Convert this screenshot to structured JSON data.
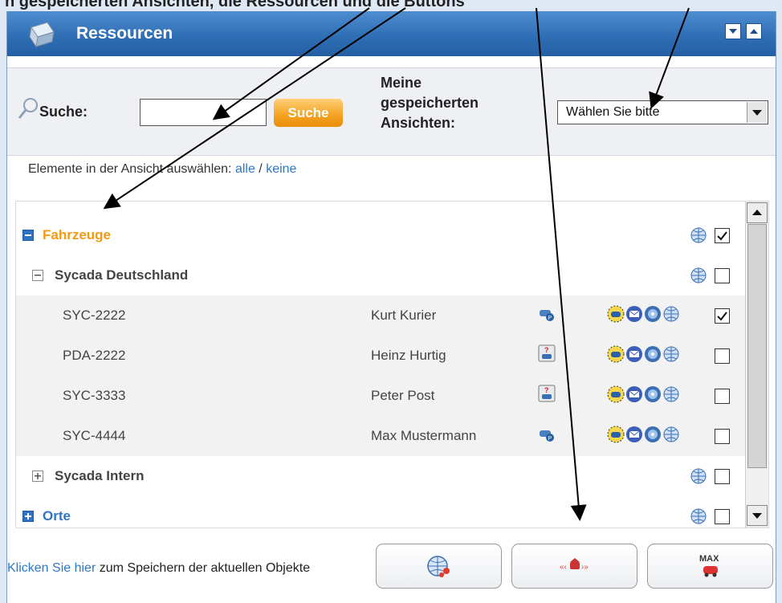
{
  "banner": {
    "text": "n gespeicherten Ansichten, die Ressourcen und die Buttons"
  },
  "window": {
    "title": "Ressourcen",
    "title_icon": "ressourcen-icon",
    "minimize_icon": "minimize-icon",
    "maximize_icon": "maximize-icon"
  },
  "search": {
    "label": "Suche:",
    "input_value": "",
    "button_label": "Suche",
    "views_label": "Meine gespeicherten Ansichten:",
    "views_selected": "Wählen Sie bitte"
  },
  "selection": {
    "prefix": "Elemente in der Ansicht auswählen: ",
    "all_link": "alle",
    "separator": " / ",
    "none_link": "keine"
  },
  "tree": {
    "groups": [
      {
        "label": "Fahrzeuge",
        "expanded": true,
        "checked": true
      },
      {
        "label": "Sycada Deutschland",
        "expanded": true,
        "checked": false
      },
      {
        "label": "Sycada Intern",
        "expanded": false,
        "checked": false
      },
      {
        "label": "Orte",
        "expanded": false,
        "checked": false
      }
    ],
    "vehicles": [
      {
        "id": "SYC-2222",
        "driver": "Kurt Kurier",
        "status_icon": "parked-car-icon",
        "checked": true
      },
      {
        "id": "PDA-2222",
        "driver": "Heinz Hurtig",
        "status_icon": "unknown-car-icon",
        "checked": false
      },
      {
        "id": "SYC-3333",
        "driver": "Peter Post",
        "status_icon": "unknown-car-icon",
        "checked": false
      },
      {
        "id": "SYC-4444",
        "driver": "Max Mustermann",
        "status_icon": "parked-car-icon",
        "checked": false
      }
    ],
    "row_action_icons": [
      "car-locate-icon",
      "message-icon",
      "route-icon",
      "globe-icon"
    ]
  },
  "footer": {
    "link": "Klicken Sie hier",
    "text": " zum Speichern der aktuellen Objekte",
    "buttons": [
      {
        "icon": "globe-network-icon"
      },
      {
        "icon": "center-vehicle-icon"
      },
      {
        "icon": "max-vehicle-icon",
        "label": "MAX"
      }
    ]
  },
  "colors": {
    "title_bar": "#2f6fb5",
    "accent_orange": "#f39a12",
    "link_blue": "#2a79c9"
  }
}
